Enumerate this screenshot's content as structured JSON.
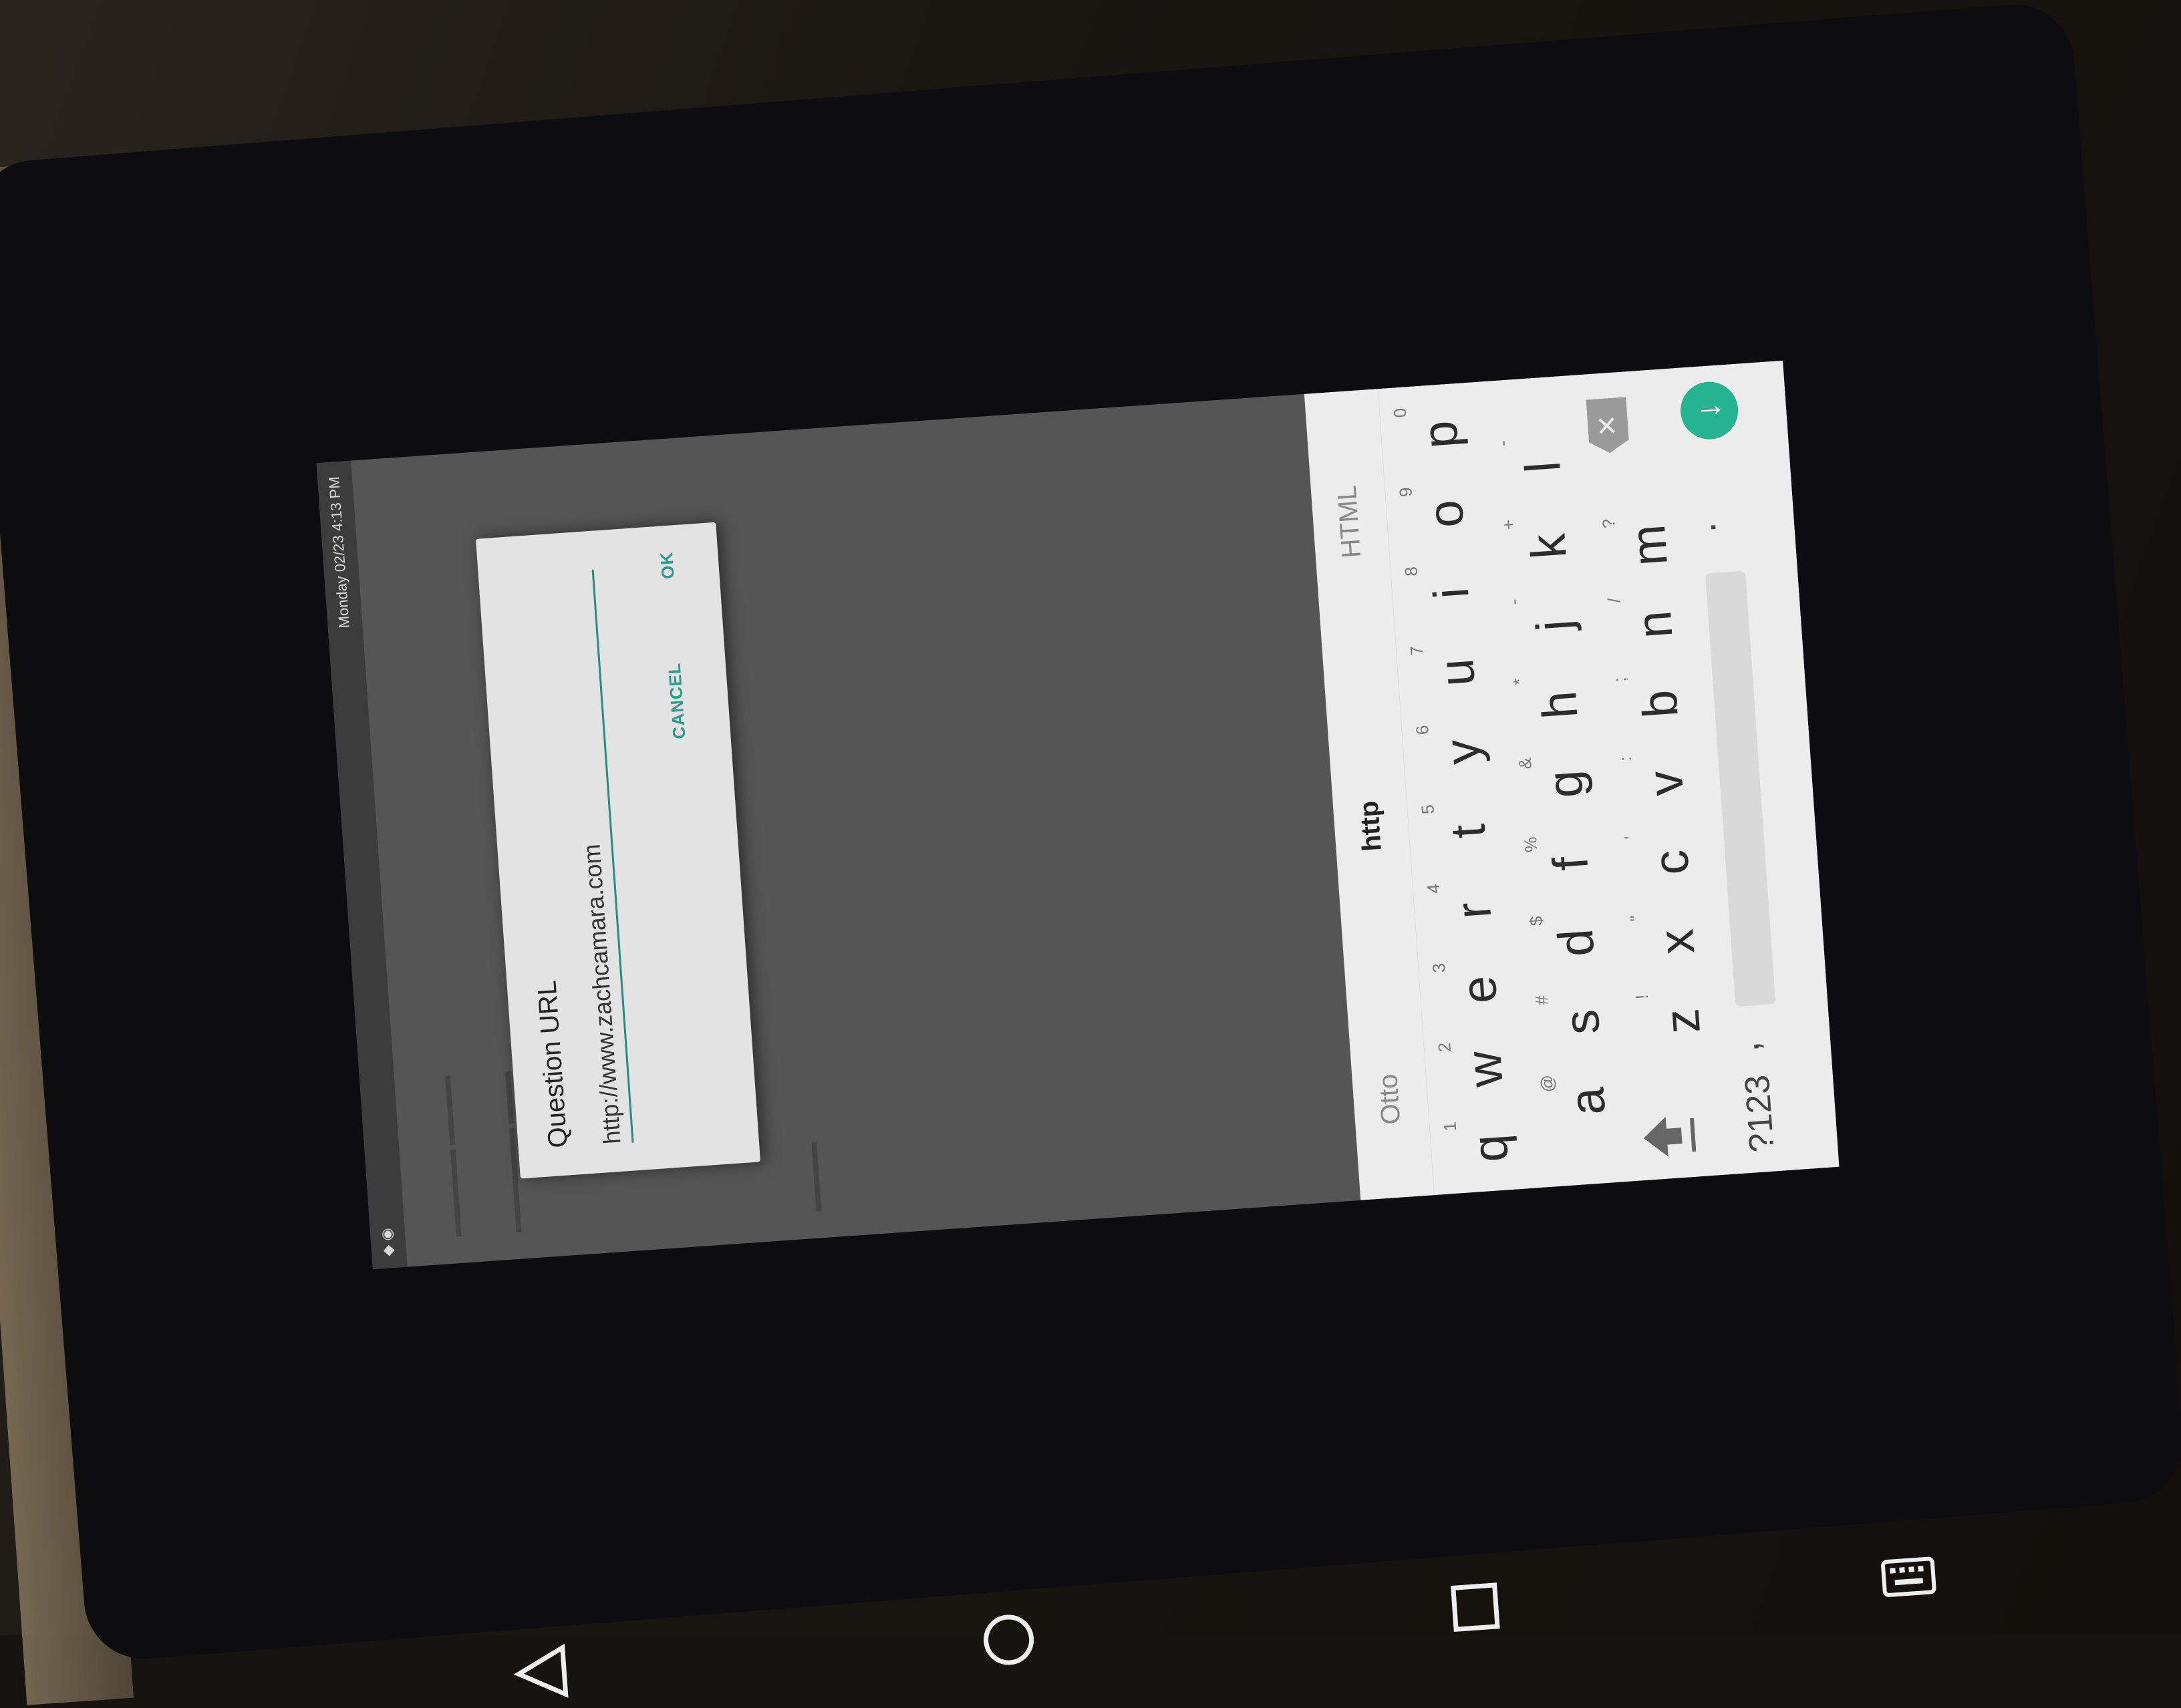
{
  "status_bar": {
    "time": "Monday 02/23 4:13 PM"
  },
  "dialog": {
    "title": "Question URL",
    "input_value": "http://www.zachcamara.com",
    "cancel_label": "CANCEL",
    "ok_label": "OK"
  },
  "keyboard": {
    "suggestions": [
      "Otto",
      "http",
      "HTML"
    ],
    "row1": [
      {
        "key": "q",
        "hint": "1"
      },
      {
        "key": "w",
        "hint": "2"
      },
      {
        "key": "e",
        "hint": "3"
      },
      {
        "key": "r",
        "hint": "4"
      },
      {
        "key": "t",
        "hint": "5"
      },
      {
        "key": "y",
        "hint": "6"
      },
      {
        "key": "u",
        "hint": "7"
      },
      {
        "key": "i",
        "hint": "8"
      },
      {
        "key": "o",
        "hint": "9"
      },
      {
        "key": "p",
        "hint": "0"
      }
    ],
    "row2": [
      {
        "key": "a",
        "hint": "@"
      },
      {
        "key": "s",
        "hint": "#"
      },
      {
        "key": "d",
        "hint": "$"
      },
      {
        "key": "f",
        "hint": "%"
      },
      {
        "key": "g",
        "hint": "&"
      },
      {
        "key": "h",
        "hint": "*"
      },
      {
        "key": "j",
        "hint": "-"
      },
      {
        "key": "k",
        "hint": "+"
      },
      {
        "key": "l",
        "hint": "-"
      }
    ],
    "row3": [
      {
        "key": "z",
        "hint": "!"
      },
      {
        "key": "x",
        "hint": "\""
      },
      {
        "key": "c",
        "hint": "'"
      },
      {
        "key": "v",
        "hint": ":"
      },
      {
        "key": "b",
        "hint": ";"
      },
      {
        "key": "n",
        "hint": "/"
      },
      {
        "key": "m",
        "hint": "?"
      }
    ],
    "symbols_label": "?123",
    "comma_label": ",",
    "period_label": ".",
    "enter_icon": "arrow-down-enter-icon",
    "accent_color": "#26b38f"
  },
  "navbar": {
    "icons": [
      "back-icon",
      "home-icon",
      "recents-icon",
      "keyboard-switch-icon"
    ]
  }
}
